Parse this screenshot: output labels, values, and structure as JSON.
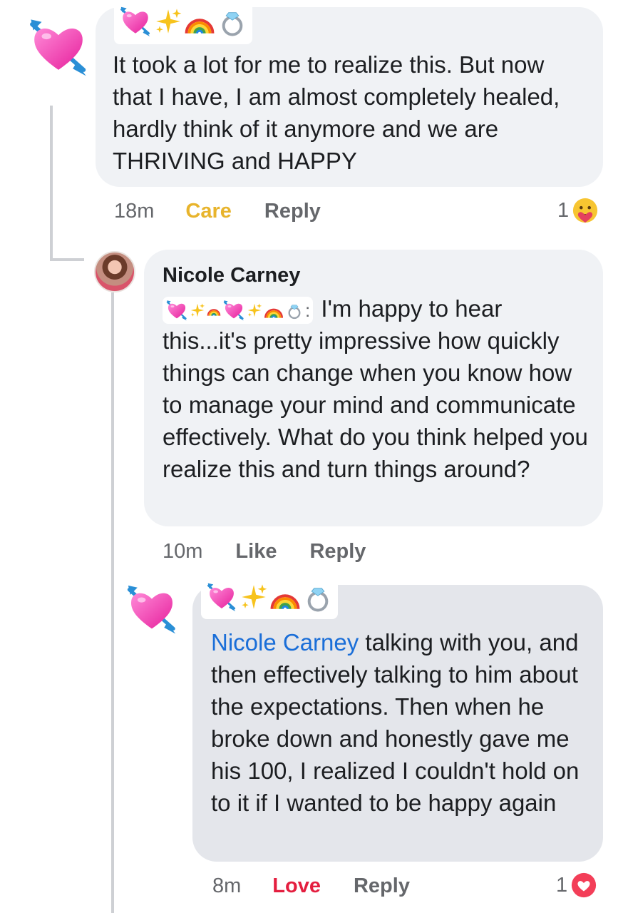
{
  "comments": [
    {
      "text": "It took a lot for me to realize this. But now that I have, I am almost completely healed, hardly think of it anymore and we are THRIVING and HAPPY",
      "time": "18m",
      "reaction_label": "Care",
      "reply_label": "Reply",
      "reaction_count": "1",
      "reaction_icon": "care-emoji-icon",
      "avatar_icon": "heart-with-arrow-icon",
      "name_emojis": [
        "heart-with-arrow-icon",
        "sparkles-icon",
        "rainbow-icon",
        "ring-icon"
      ]
    },
    {
      "author": "Nicole Carney",
      "tag_separator": ":",
      "text": "I'm happy to hear this...it's pretty impressive how quickly things can change when you know how to manage your mind and communicate effectively. What do you think helped you realize this and turn things around?",
      "time": "10m",
      "reaction_label": "Like",
      "reply_label": "Reply",
      "avatar_icon": "profile-photo"
    },
    {
      "mention": "Nicole Carney",
      "text": "talking with you, and then effectively talking to him about the expectations. Then when he broke down and honestly gave me his 100, I realized I couldn't hold on to it if I wanted to be happy again",
      "time": "8m",
      "reaction_label": "Love",
      "reply_label": "Reply",
      "reaction_count": "1",
      "reaction_icon": "love-heart-icon",
      "avatar_icon": "heart-with-arrow-icon",
      "name_emojis": [
        "heart-with-arrow-icon",
        "sparkles-icon",
        "rainbow-icon",
        "ring-icon"
      ]
    }
  ],
  "colors": {
    "bubble": "#f0f2f5",
    "bubble_selected": "#e4e6eb",
    "care": "#e8b42c",
    "love": "#e41e3f",
    "mention": "#1a6ed8",
    "meta": "#65676b"
  }
}
